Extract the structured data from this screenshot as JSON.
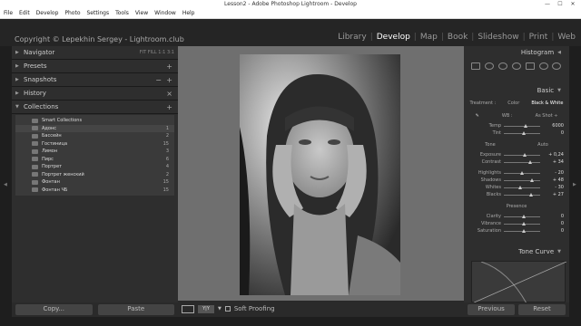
{
  "window": {
    "title": "Lesson2 - Adobe Photoshop Lightroom - Develop",
    "minimize": "—",
    "maximize": "☐",
    "close": "✕"
  },
  "menu": [
    "File",
    "Edit",
    "Develop",
    "Photo",
    "Settings",
    "Tools",
    "View",
    "Window",
    "Help"
  ],
  "identity_plate": "Copyright © Lepekhin Sergey - Lightroom.club",
  "modules": [
    "Library",
    "Develop",
    "Map",
    "Book",
    "Slideshow",
    "Print",
    "Web"
  ],
  "active_module": "Develop",
  "left_panel": {
    "navigator": "Navigator",
    "navigator_options": "FIT FILL 1:1 3:1",
    "presets": "Presets",
    "snapshots": "Snapshots",
    "history": "History",
    "collections": "Collections",
    "collection_items": [
      {
        "label": "Smart Collections",
        "count": ""
      },
      {
        "label": "Адонс",
        "count": "1"
      },
      {
        "label": "Бассейн",
        "count": "2"
      },
      {
        "label": "Гостиница",
        "count": "15"
      },
      {
        "label": "Лимон",
        "count": "3"
      },
      {
        "label": "Пирс",
        "count": "6"
      },
      {
        "label": "Портрет",
        "count": "4"
      },
      {
        "label": "Портрет женский",
        "count": "2"
      },
      {
        "label": "Фонтан",
        "count": "15"
      },
      {
        "label": "Фонтан ЧБ",
        "count": "15"
      }
    ],
    "copy_button": "Copy...",
    "paste_button": "Paste"
  },
  "toolbar": {
    "yy_label": "Y|Y",
    "soft_proofing": "Soft Proofing"
  },
  "right_panel": {
    "histogram": "Histogram",
    "basic": "Basic",
    "treatment_label": "Treatment :",
    "treatment_color": "Color",
    "treatment_bw": "Black & White",
    "wb_label": "WB :",
    "wb_value": "As Shot ÷",
    "tone_label": "Tone",
    "tone_auto": "Auto",
    "presence_label": "Presence",
    "sliders": [
      {
        "label": "Temp",
        "value": "6000"
      },
      {
        "label": "Tint",
        "value": "0"
      },
      {
        "label": "Exposure",
        "value": "+ 0,24"
      },
      {
        "label": "Contrast",
        "value": "+ 34"
      },
      {
        "label": "Highlights",
        "value": "- 20"
      },
      {
        "label": "Shadows",
        "value": "+ 48"
      },
      {
        "label": "Whites",
        "value": "- 30"
      },
      {
        "label": "Blacks",
        "value": "+ 27"
      },
      {
        "label": "Clarity",
        "value": "0"
      },
      {
        "label": "Vibrance",
        "value": "0"
      },
      {
        "label": "Saturation",
        "value": "0"
      }
    ],
    "tone_curve": "Tone Curve",
    "previous_button": "Previous",
    "reset_button": "Reset"
  }
}
